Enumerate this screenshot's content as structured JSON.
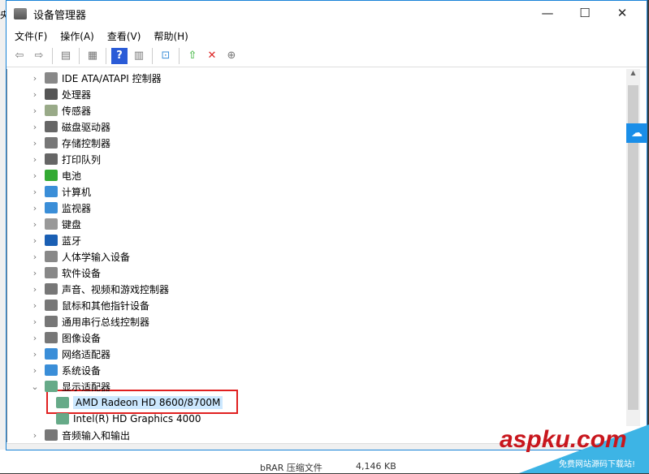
{
  "window": {
    "title": "设备管理器",
    "minimize": "—",
    "maximize": "☐",
    "close": "✕"
  },
  "menu": [
    "文件(F)",
    "操作(A)",
    "查看(V)",
    "帮助(H)"
  ],
  "tree": [
    {
      "label": "IDE ATA/ATAPI 控制器",
      "color": "#888"
    },
    {
      "label": "处理器",
      "color": "#555"
    },
    {
      "label": "传感器",
      "color": "#9a8"
    },
    {
      "label": "磁盘驱动器",
      "color": "#666"
    },
    {
      "label": "存储控制器",
      "color": "#777"
    },
    {
      "label": "打印队列",
      "color": "#666"
    },
    {
      "label": "电池",
      "color": "#3a3"
    },
    {
      "label": "计算机",
      "color": "#3a8ed8"
    },
    {
      "label": "监视器",
      "color": "#3a8ed8"
    },
    {
      "label": "键盘",
      "color": "#999"
    },
    {
      "label": "蓝牙",
      "color": "#1a5fb4"
    },
    {
      "label": "人体学输入设备",
      "color": "#888"
    },
    {
      "label": "软件设备",
      "color": "#888"
    },
    {
      "label": "声音、视频和游戏控制器",
      "color": "#777"
    },
    {
      "label": "鼠标和其他指针设备",
      "color": "#777"
    },
    {
      "label": "通用串行总线控制器",
      "color": "#777"
    },
    {
      "label": "图像设备",
      "color": "#777"
    },
    {
      "label": "网络适配器",
      "color": "#3a8ed8"
    },
    {
      "label": "系统设备",
      "color": "#3a8ed8"
    },
    {
      "label": "显示适配器",
      "color": "#6a8",
      "expanded": true
    },
    {
      "label": "AMD Radeon HD 8600/8700M",
      "color": "#6a8",
      "child": true,
      "selected": true
    },
    {
      "label": "Intel(R) HD Graphics 4000",
      "color": "#6a8",
      "child": true
    },
    {
      "label": "音频输入和输出",
      "color": "#777"
    }
  ],
  "background": {
    "file_type": "bRAR 压缩文件",
    "file_size": "4,146 KB",
    "left_char": "央"
  },
  "watermark": {
    "logo": "aspku.com",
    "tagline": "免费网站源码下载站!"
  }
}
